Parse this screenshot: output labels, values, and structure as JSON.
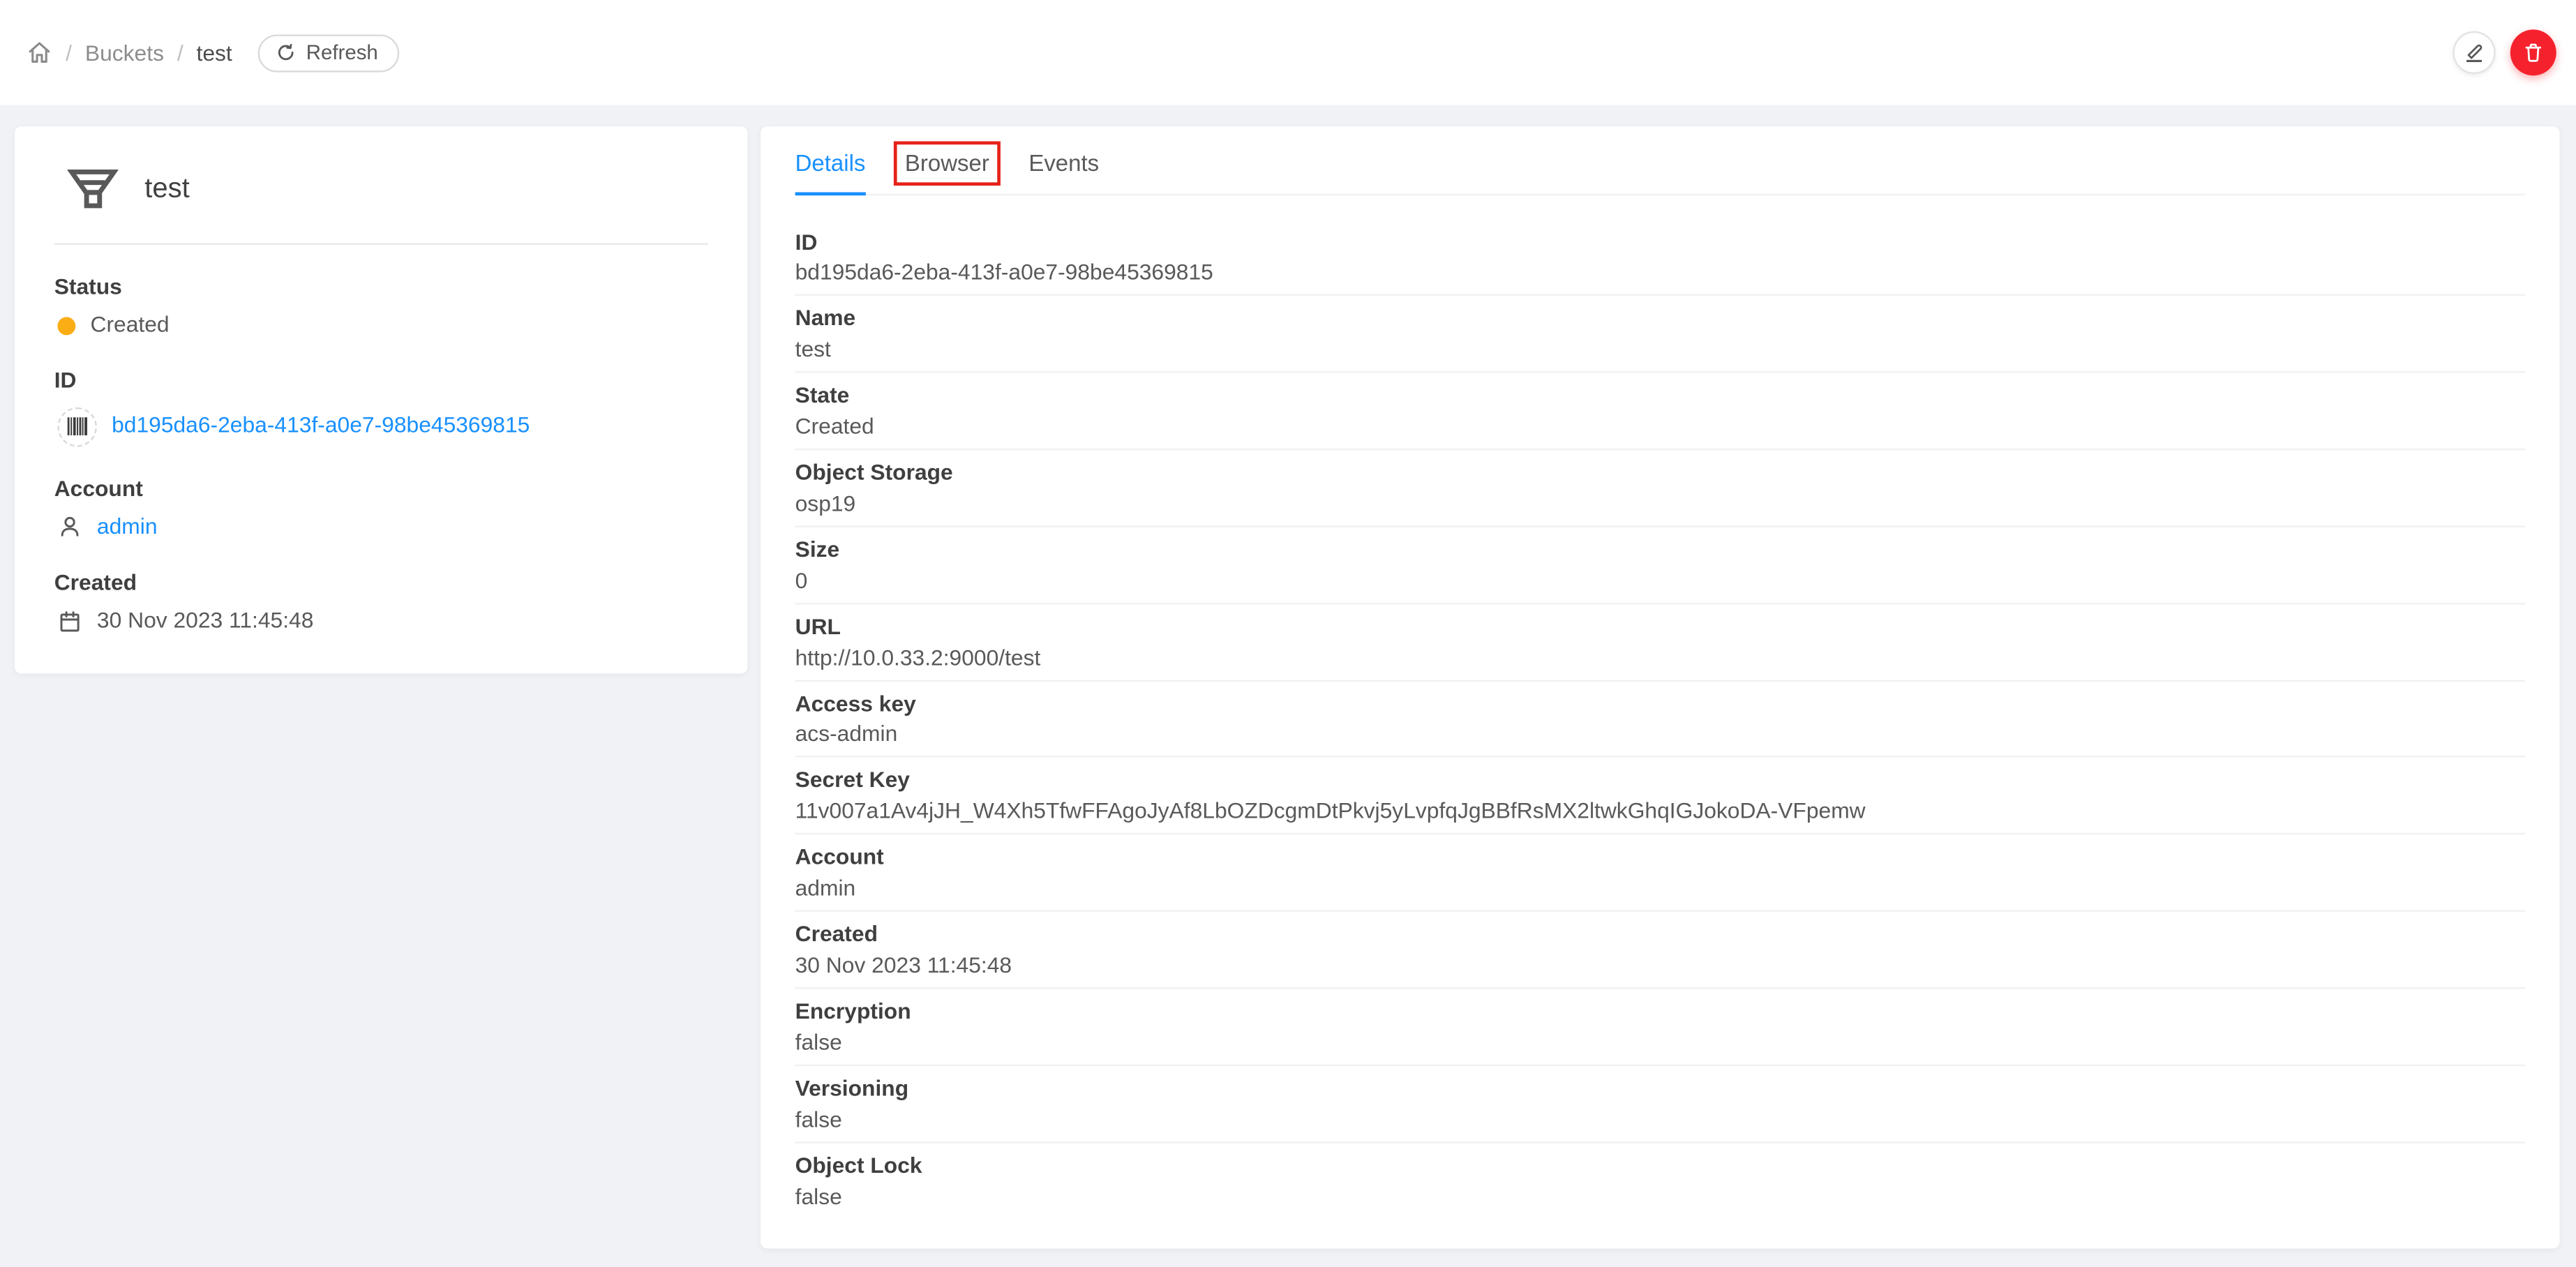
{
  "colors": {
    "accent": "#1890ff",
    "status_created": "#faad14",
    "danger_red": "#f5222d",
    "annotation_red": "#e62319",
    "page_background": "#f0f2f5"
  },
  "header": {
    "breadcrumb": {
      "separator": "/",
      "items": [
        {
          "label": "Buckets"
        },
        {
          "label": "test"
        }
      ]
    },
    "refresh_label": "Refresh",
    "icons": [
      "home-icon",
      "reload-icon",
      "edit-icon",
      "delete-icon"
    ]
  },
  "resource": {
    "title": "test",
    "icon": "bucket-funnel-icon",
    "sections": {
      "status": {
        "label": "Status",
        "value": "Created"
      },
      "id": {
        "label": "ID",
        "value": "bd195da6-2eba-413f-a0e7-98be45369815",
        "icon": "barcode-icon"
      },
      "account": {
        "label": "Account",
        "value": "admin",
        "icon": "user-icon"
      },
      "created": {
        "label": "Created",
        "value": "30 Nov 2023 11:45:48",
        "icon": "calendar-icon"
      }
    }
  },
  "tabs": {
    "items": [
      {
        "label": "Details",
        "active": true
      },
      {
        "label": "Browser",
        "active": false,
        "annotated": true
      },
      {
        "label": "Events",
        "active": false
      }
    ]
  },
  "annotation": {
    "target_tab": "Browser"
  },
  "details": {
    "rows": [
      {
        "label": "ID",
        "value": "bd195da6-2eba-413f-a0e7-98be45369815"
      },
      {
        "label": "Name",
        "value": "test"
      },
      {
        "label": "State",
        "value": "Created"
      },
      {
        "label": "Object Storage",
        "value": "osp19"
      },
      {
        "label": "Size",
        "value": "0"
      },
      {
        "label": "URL",
        "value": "http://10.0.33.2:9000/test"
      },
      {
        "label": "Access key",
        "value": "acs-admin"
      },
      {
        "label": "Secret Key",
        "value": "11v007a1Av4jJH_W4Xh5TfwFFAgoJyAf8LbOZDcgmDtPkvj5yLvpfqJgBBfRsMX2ltwkGhqIGJokoDA-VFpemw"
      },
      {
        "label": "Account",
        "value": "admin"
      },
      {
        "label": "Created",
        "value": "30 Nov 2023 11:45:48"
      },
      {
        "label": "Encryption",
        "value": "false"
      },
      {
        "label": "Versioning",
        "value": "false"
      },
      {
        "label": "Object Lock",
        "value": "false"
      }
    ]
  }
}
